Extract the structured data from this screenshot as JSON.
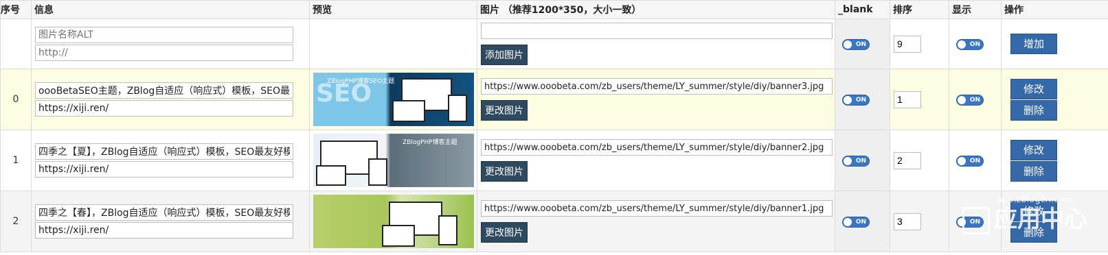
{
  "headers": {
    "index": "序号",
    "info": "信息",
    "preview": "预览",
    "image": "图片 （推荐1200*350，大小一致）",
    "blank": "_blank",
    "order": "排序",
    "show": "显示",
    "actions": "操作"
  },
  "new_row": {
    "alt_placeholder": "图片名称ALT",
    "link_placeholder": "http://",
    "image_url": "",
    "upload_button": "添加图片",
    "blank_toggle": "ON",
    "order": "9",
    "show_toggle": "ON",
    "add_button": "增加"
  },
  "rows": [
    {
      "index": "0",
      "alt": "oooBetaSEO主题，ZBlog自适应（响应式）模板，SEO最友好",
      "link": "https://xiji.ren/",
      "preview_text": "SEO",
      "preview_heading": "ZBlogPHP博客SEO主题",
      "image_url": "https://www.ooobeta.com/zb_users/theme/LY_summer/style/diy/banner3.jpg",
      "change_button": "更改图片",
      "blank_toggle": "ON",
      "order": "1",
      "show_toggle": "ON",
      "edit_button": "修改",
      "delete_button": "删除"
    },
    {
      "index": "1",
      "alt": "四季之【夏】，ZBlog自适应（响应式）模板，SEO最友好模板",
      "link": "https://xiji.ren/",
      "preview_text": "",
      "preview_heading": "ZBlogPHP博客主题",
      "image_url": "https://www.ooobeta.com/zb_users/theme/LY_summer/style/diy/banner2.jpg",
      "change_button": "更改图片",
      "blank_toggle": "ON",
      "order": "2",
      "show_toggle": "ON",
      "edit_button": "修改",
      "delete_button": "删除"
    },
    {
      "index": "2",
      "alt": "四季之【春】，ZBlog自适应（响应式）模板，SEO最友好模板",
      "link": "https://xiji.ren/",
      "preview_text": "",
      "preview_heading": "",
      "image_url": "https://www.ooobeta.com/zb_users/theme/LY_summer/style/diy/banner1.jpg",
      "change_button": "更改图片",
      "blank_toggle": "ON",
      "order": "3",
      "show_toggle": "ON",
      "edit_button": "修改",
      "delete_button": "删除"
    }
  ],
  "watermark": {
    "site": "app.zblogcn.com",
    "text": "应用中心"
  },
  "colors": {
    "toggle": "#3a76c2",
    "action_button": "#3568a6",
    "upload_button": "#2f4a5f",
    "highlight_row": "#fdfde2"
  }
}
